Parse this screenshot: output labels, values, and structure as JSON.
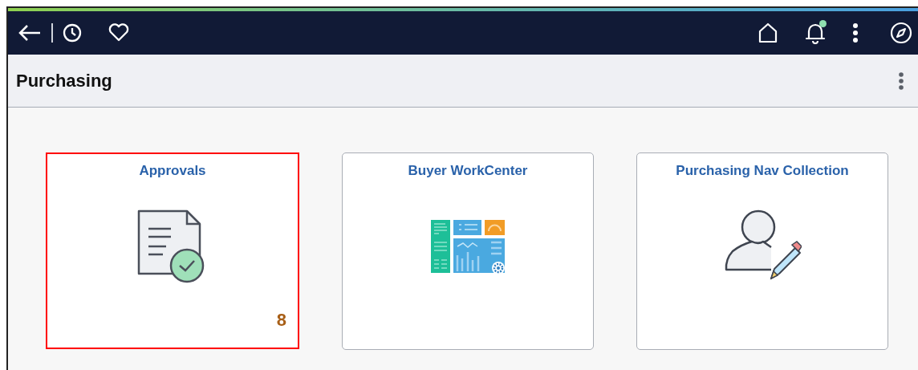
{
  "header": {
    "notification_dot": true
  },
  "page": {
    "title": "Purchasing"
  },
  "tiles": [
    {
      "title": "Approvals",
      "kind": "approval",
      "count": "8",
      "selected": true
    },
    {
      "title": "Buyer WorkCenter",
      "kind": "workcenter",
      "selected": false
    },
    {
      "title": "Purchasing Nav Collection",
      "kind": "person-edit",
      "selected": false
    }
  ]
}
